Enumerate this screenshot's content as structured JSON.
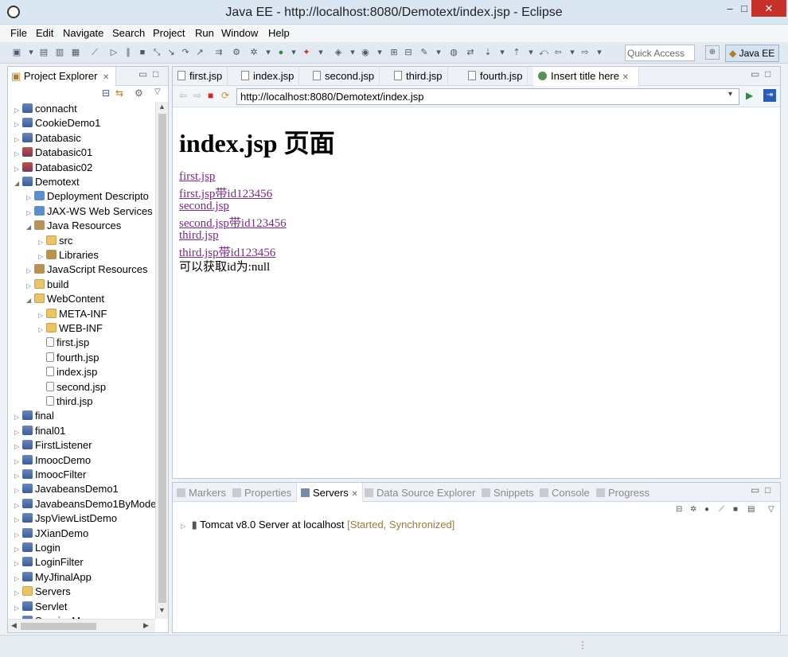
{
  "window": {
    "title": "Java EE - http://localhost:8080/Demotext/index.jsp - Eclipse",
    "minimize": "–",
    "maximize": "□",
    "close": "✕"
  },
  "menu": [
    "File",
    "Edit",
    "Navigate",
    "Search",
    "Project",
    "Run",
    "Window",
    "Help"
  ],
  "toolbar": {
    "quick_access_placeholder": "Quick Access",
    "perspective": "Java EE"
  },
  "project_explorer": {
    "tab_label": "Project Explorer",
    "tab_close": "✕",
    "items": [
      {
        "label": "connacht",
        "depth": 0,
        "expanded": false,
        "icon": "project-icon"
      },
      {
        "label": "CookieDemo1",
        "depth": 0,
        "expanded": false,
        "icon": "project-icon"
      },
      {
        "label": "Databasic",
        "depth": 0,
        "expanded": false,
        "icon": "project-icon"
      },
      {
        "label": "Databasic01",
        "depth": 0,
        "expanded": false,
        "icon": "project-error-icon"
      },
      {
        "label": "Databasic02",
        "depth": 0,
        "expanded": false,
        "icon": "project-error-icon"
      },
      {
        "label": "Demotext",
        "depth": 0,
        "expanded": true,
        "icon": "project-icon"
      },
      {
        "label": "Deployment Descripto",
        "depth": 1,
        "expanded": false,
        "icon": "deployment-icon"
      },
      {
        "label": "JAX-WS Web Services",
        "depth": 1,
        "expanded": false,
        "icon": "webservice-icon"
      },
      {
        "label": "Java Resources",
        "depth": 1,
        "expanded": true,
        "icon": "java-resources-icon"
      },
      {
        "label": "src",
        "depth": 2,
        "expanded": false,
        "icon": "package-folder-icon"
      },
      {
        "label": "Libraries",
        "depth": 2,
        "expanded": false,
        "icon": "library-icon"
      },
      {
        "label": "JavaScript Resources",
        "depth": 1,
        "expanded": false,
        "icon": "javascript-icon"
      },
      {
        "label": "build",
        "depth": 1,
        "expanded": false,
        "icon": "folder-icon"
      },
      {
        "label": "WebContent",
        "depth": 1,
        "expanded": true,
        "icon": "folder-icon"
      },
      {
        "label": "META-INF",
        "depth": 2,
        "expanded": false,
        "icon": "folder-icon"
      },
      {
        "label": "WEB-INF",
        "depth": 2,
        "expanded": false,
        "icon": "folder-icon"
      },
      {
        "label": "first.jsp",
        "depth": 2,
        "leaf": true,
        "icon": "jsp-file-icon"
      },
      {
        "label": "fourth.jsp",
        "depth": 2,
        "leaf": true,
        "icon": "jsp-file-icon"
      },
      {
        "label": "index.jsp",
        "depth": 2,
        "leaf": true,
        "icon": "jsp-file-icon"
      },
      {
        "label": "second.jsp",
        "depth": 2,
        "leaf": true,
        "icon": "jsp-file-icon"
      },
      {
        "label": "third.jsp",
        "depth": 2,
        "leaf": true,
        "icon": "jsp-file-icon"
      },
      {
        "label": "final",
        "depth": 0,
        "expanded": false,
        "icon": "project-icon"
      },
      {
        "label": "final01",
        "depth": 0,
        "expanded": false,
        "icon": "project-icon"
      },
      {
        "label": "FirstListener",
        "depth": 0,
        "expanded": false,
        "icon": "project-icon"
      },
      {
        "label": "ImoocDemo",
        "depth": 0,
        "expanded": false,
        "icon": "project-icon"
      },
      {
        "label": "ImoocFilter",
        "depth": 0,
        "expanded": false,
        "icon": "project-icon"
      },
      {
        "label": "JavabeansDemo1",
        "depth": 0,
        "expanded": false,
        "icon": "project-icon"
      },
      {
        "label": "JavabeansDemo1ByMode",
        "depth": 0,
        "expanded": false,
        "icon": "project-icon"
      },
      {
        "label": "JspViewListDemo",
        "depth": 0,
        "expanded": false,
        "icon": "project-icon"
      },
      {
        "label": "JXianDemo",
        "depth": 0,
        "expanded": false,
        "icon": "project-icon"
      },
      {
        "label": "Login",
        "depth": 0,
        "expanded": false,
        "icon": "project-icon"
      },
      {
        "label": "LoginFilter",
        "depth": 0,
        "expanded": false,
        "icon": "project-icon"
      },
      {
        "label": "MyJfinalApp",
        "depth": 0,
        "expanded": false,
        "icon": "project-icon"
      },
      {
        "label": "Servers",
        "depth": 0,
        "expanded": false,
        "icon": "servers-folder-icon"
      },
      {
        "label": "Servlet",
        "depth": 0,
        "expanded": false,
        "icon": "project-icon"
      },
      {
        "label": "SessionM",
        "depth": 0,
        "expanded": false,
        "icon": "project-icon"
      }
    ]
  },
  "editor": {
    "tabs": [
      {
        "label": "first.jsp",
        "active": false
      },
      {
        "label": "index.jsp",
        "active": false
      },
      {
        "label": "second.jsp",
        "active": false
      },
      {
        "label": "third.jsp",
        "active": false
      },
      {
        "label": "fourth.jsp",
        "active": false
      },
      {
        "label": "Insert title here",
        "active": true,
        "close": "✕"
      }
    ],
    "url": "http://localhost:8080/Demotext/index.jsp",
    "page": {
      "heading": "index.jsp 页面",
      "links": [
        "first.jsp",
        "first.jsp带id123456",
        "second.jsp",
        "second.jsp带id123456",
        "third.jsp",
        "third.jsp带id123456"
      ],
      "text": "可以获取id为:null"
    }
  },
  "bottom_panel": {
    "tabs": [
      {
        "label": "Markers",
        "active": false
      },
      {
        "label": "Properties",
        "active": false
      },
      {
        "label": "Servers",
        "active": true,
        "close": "✕"
      },
      {
        "label": "Data Source Explorer",
        "active": false
      },
      {
        "label": "Snippets",
        "active": false
      },
      {
        "label": "Console",
        "active": false
      },
      {
        "label": "Progress",
        "active": false
      }
    ],
    "server": {
      "name": "Tomcat v8.0 Server at localhost",
      "status": "[Started, Synchronized]"
    }
  }
}
